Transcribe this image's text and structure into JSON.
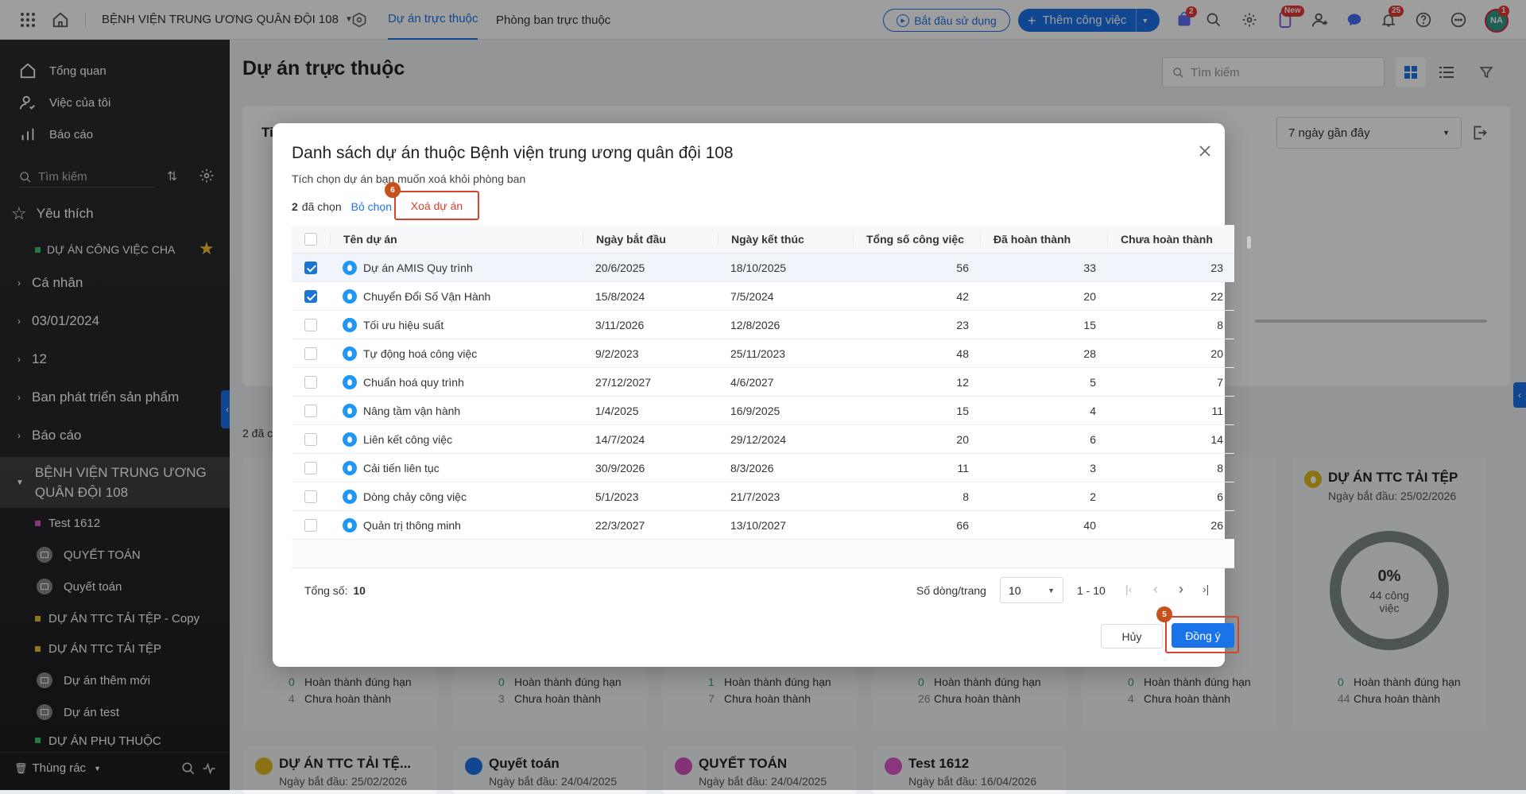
{
  "topbar": {
    "org_name": "BỆNH VIỆN TRUNG ƯƠNG QUÂN ĐỘI 108",
    "tabs": [
      {
        "label": "Dự án trực thuộc",
        "active": true
      },
      {
        "label": "Phòng ban trực thuộc",
        "active": false
      }
    ],
    "start_button": "Bắt đầu sử dụng",
    "add_button": "Thêm công việc",
    "cart_badge": "2",
    "new_badge": "New",
    "notif_badge": "25",
    "avatar_text": "NA",
    "avatar_badge": "1"
  },
  "sidebar": {
    "nav": [
      {
        "label": "Tổng quan",
        "icon": "home-icon"
      },
      {
        "label": "Việc của tôi",
        "icon": "user-check-icon"
      },
      {
        "label": "Báo cáo",
        "icon": "bar-chart-icon"
      }
    ],
    "search_placeholder": "Tìm kiếm",
    "favorites_title": "Yêu thích",
    "favorite_item": "DỰ ÁN CÔNG VIỆC CHA",
    "groups": [
      "Cá nhân",
      "03/01/2024",
      "12",
      "Ban phát triển sản phẩm",
      "Báo cáo"
    ],
    "active_group": "BỆNH VIỆN TRUNG ƯƠNG QUÂN ĐỘI 108",
    "children": [
      {
        "label": "Test 1612",
        "type": "dot",
        "color": "#e056c9"
      },
      {
        "label": "QUYẾT TOÁN",
        "type": "archive"
      },
      {
        "label": "Quyết toán",
        "type": "archive"
      },
      {
        "label": "DỰ ÁN TTC TẢI TỆP - Copy",
        "type": "dot",
        "color": "#e0c030"
      },
      {
        "label": "DỰ ÁN TTC TẢI TỆP",
        "type": "dot",
        "color": "#e0c030"
      },
      {
        "label": "Dự án thêm mới",
        "type": "archive"
      },
      {
        "label": "Dự án test",
        "type": "archive"
      },
      {
        "label": "DỰ ÁN PHỤ THUỘC",
        "type": "dot",
        "color": "#3cc46a"
      }
    ],
    "trash_label": "Thùng rác"
  },
  "main": {
    "title": "Dự án trực thuộc",
    "search_placeholder": "Tìm kiếm",
    "period_select": "7 ngày gần đây",
    "count_text": "2 đã c",
    "partial_header": "Ti",
    "right_card": {
      "title": "DỰ ÁN TTC TẢI TỆP",
      "start_date": "Ngày bắt đầu: 25/02/2026",
      "percent": "0%",
      "tasks_line1": "44 công",
      "tasks_line2": "việc",
      "done_on_time_label": "Hoàn thành đúng hạn",
      "not_done_label": "Chưa hoàn thành",
      "done_on_time": "0",
      "not_done": "44"
    },
    "card_stats": [
      {
        "done": "0",
        "not_done": "4"
      },
      {
        "done": "0",
        "not_done": "3"
      },
      {
        "done": "1",
        "not_done": "7"
      },
      {
        "done": "0",
        "not_done": "26"
      },
      {
        "done": "0",
        "not_done": "4"
      }
    ],
    "bottom_cards": [
      {
        "title": "DỰ ÁN TTC TẢI TỆ...",
        "start": "Ngày bắt đầu: 25/02/2026"
      },
      {
        "title": "Quyết toán",
        "start": "Ngày bắt đầu: 24/04/2025"
      },
      {
        "title": "QUYẾT TOÁN",
        "start": "Ngày bắt đầu: 24/04/2025"
      },
      {
        "title": "Test 1612",
        "start": "Ngày bắt đầu: 16/04/2026"
      }
    ]
  },
  "modal": {
    "title": "Danh sách dự án thuộc Bệnh viện trung ương quân đội 108",
    "subtitle": "Tích chọn dự án bạn muốn xoá khỏi phòng ban",
    "selected_count": "2",
    "selected_suffix": "đã chọn",
    "deselect_label": "Bỏ chọn",
    "delete_label": "Xoá dự án",
    "step_delete": "6",
    "step_ok": "5",
    "columns": [
      "Tên dự án",
      "Ngày bắt đầu",
      "Ngày kết thúc",
      "Tổng số công việc",
      "Đã hoàn thành",
      "Chưa hoàn thành"
    ],
    "rows": [
      {
        "checked": true,
        "name": "Dự án AMIS Quy trình",
        "start": "20/6/2025",
        "end": "18/10/2025",
        "total": "56",
        "done": "33",
        "todo": "23"
      },
      {
        "checked": true,
        "name": "Chuyển Đổi Số Vận Hành",
        "start": "15/8/2024",
        "end": "7/5/2024",
        "total": "42",
        "done": "20",
        "todo": "22"
      },
      {
        "checked": false,
        "name": "Tối ưu hiệu suất",
        "start": "3/11/2026",
        "end": "12/8/2026",
        "total": "23",
        "done": "15",
        "todo": "8"
      },
      {
        "checked": false,
        "name": "Tự động hoá công việc",
        "start": "9/2/2023",
        "end": "25/11/2023",
        "total": "48",
        "done": "28",
        "todo": "20"
      },
      {
        "checked": false,
        "name": "Chuẩn hoá quy trình",
        "start": "27/12/2027",
        "end": "4/6/2027",
        "total": "12",
        "done": "5",
        "todo": "7"
      },
      {
        "checked": false,
        "name": "Nâng tầm vận hành",
        "start": "1/4/2025",
        "end": "16/9/2025",
        "total": "15",
        "done": "4",
        "todo": "11"
      },
      {
        "checked": false,
        "name": "Liên kết công việc",
        "start": "14/7/2024",
        "end": "29/12/2024",
        "total": "20",
        "done": "6",
        "todo": "14"
      },
      {
        "checked": false,
        "name": "Cải tiến liên tục",
        "start": "30/9/2026",
        "end": "8/3/2026",
        "total": "11",
        "done": "3",
        "todo": "8"
      },
      {
        "checked": false,
        "name": "Dòng chảy công việc",
        "start": "5/1/2023",
        "end": "21/7/2023",
        "total": "8",
        "done": "2",
        "todo": "6"
      },
      {
        "checked": false,
        "name": "Quản trị thông minh",
        "start": "22/3/2027",
        "end": "13/10/2027",
        "total": "66",
        "done": "40",
        "todo": "26"
      }
    ],
    "total_label": "Tổng số:",
    "total_value": "10",
    "rows_per_page_label": "Số dòng/trang",
    "rows_per_page": "10",
    "range": "1 - 10",
    "cancel_label": "Hủy",
    "ok_label": "Đồng ý"
  }
}
